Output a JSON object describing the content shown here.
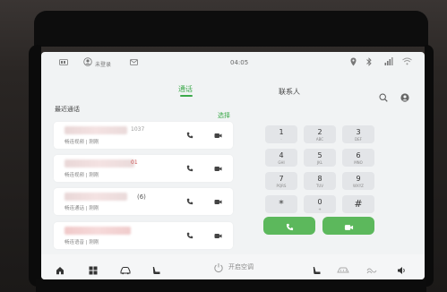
{
  "status_bar": {
    "user_label": "未登录",
    "time": "04:05",
    "icons": [
      "sim-icon",
      "user-icon",
      "message-icon",
      "location-icon",
      "bluetooth-icon",
      "signal-icon",
      "wifi-icon"
    ]
  },
  "tabs": [
    {
      "label": "通话",
      "active": true
    },
    {
      "label": "联系人",
      "active": false
    }
  ],
  "recent": {
    "title": "最近通话",
    "select_label": "选择",
    "items": [
      {
        "sub": "畅连视频 | 刚刚",
        "name_suffix": "1037",
        "count": ""
      },
      {
        "sub": "畅连视频 | 刚刚",
        "name_suffix": "01",
        "count": ""
      },
      {
        "sub": "畅连通话 | 刚刚",
        "name_suffix": "",
        "count": "(6)"
      },
      {
        "sub": "畅连语音 | 刚刚",
        "name_suffix": "",
        "count": ""
      }
    ]
  },
  "keypad": {
    "keys": [
      {
        "digit": "1",
        "letters": "·"
      },
      {
        "digit": "2",
        "letters": "ABC"
      },
      {
        "digit": "3",
        "letters": "DEF"
      },
      {
        "digit": "4",
        "letters": "GHI"
      },
      {
        "digit": "5",
        "letters": "JKL"
      },
      {
        "digit": "6",
        "letters": "MNO"
      },
      {
        "digit": "7",
        "letters": "PQRS"
      },
      {
        "digit": "8",
        "letters": "TUV"
      },
      {
        "digit": "9",
        "letters": "WXYZ"
      },
      {
        "digit": "*",
        "letters": ""
      },
      {
        "digit": "0",
        "letters": "+"
      },
      {
        "digit": "#",
        "letters": ""
      }
    ]
  },
  "dock": {
    "ac_label": "开启空调"
  },
  "colors": {
    "accent": "#3daa4b",
    "call_green": "#5cb85c",
    "screen_bg": "#f1f3f4"
  }
}
